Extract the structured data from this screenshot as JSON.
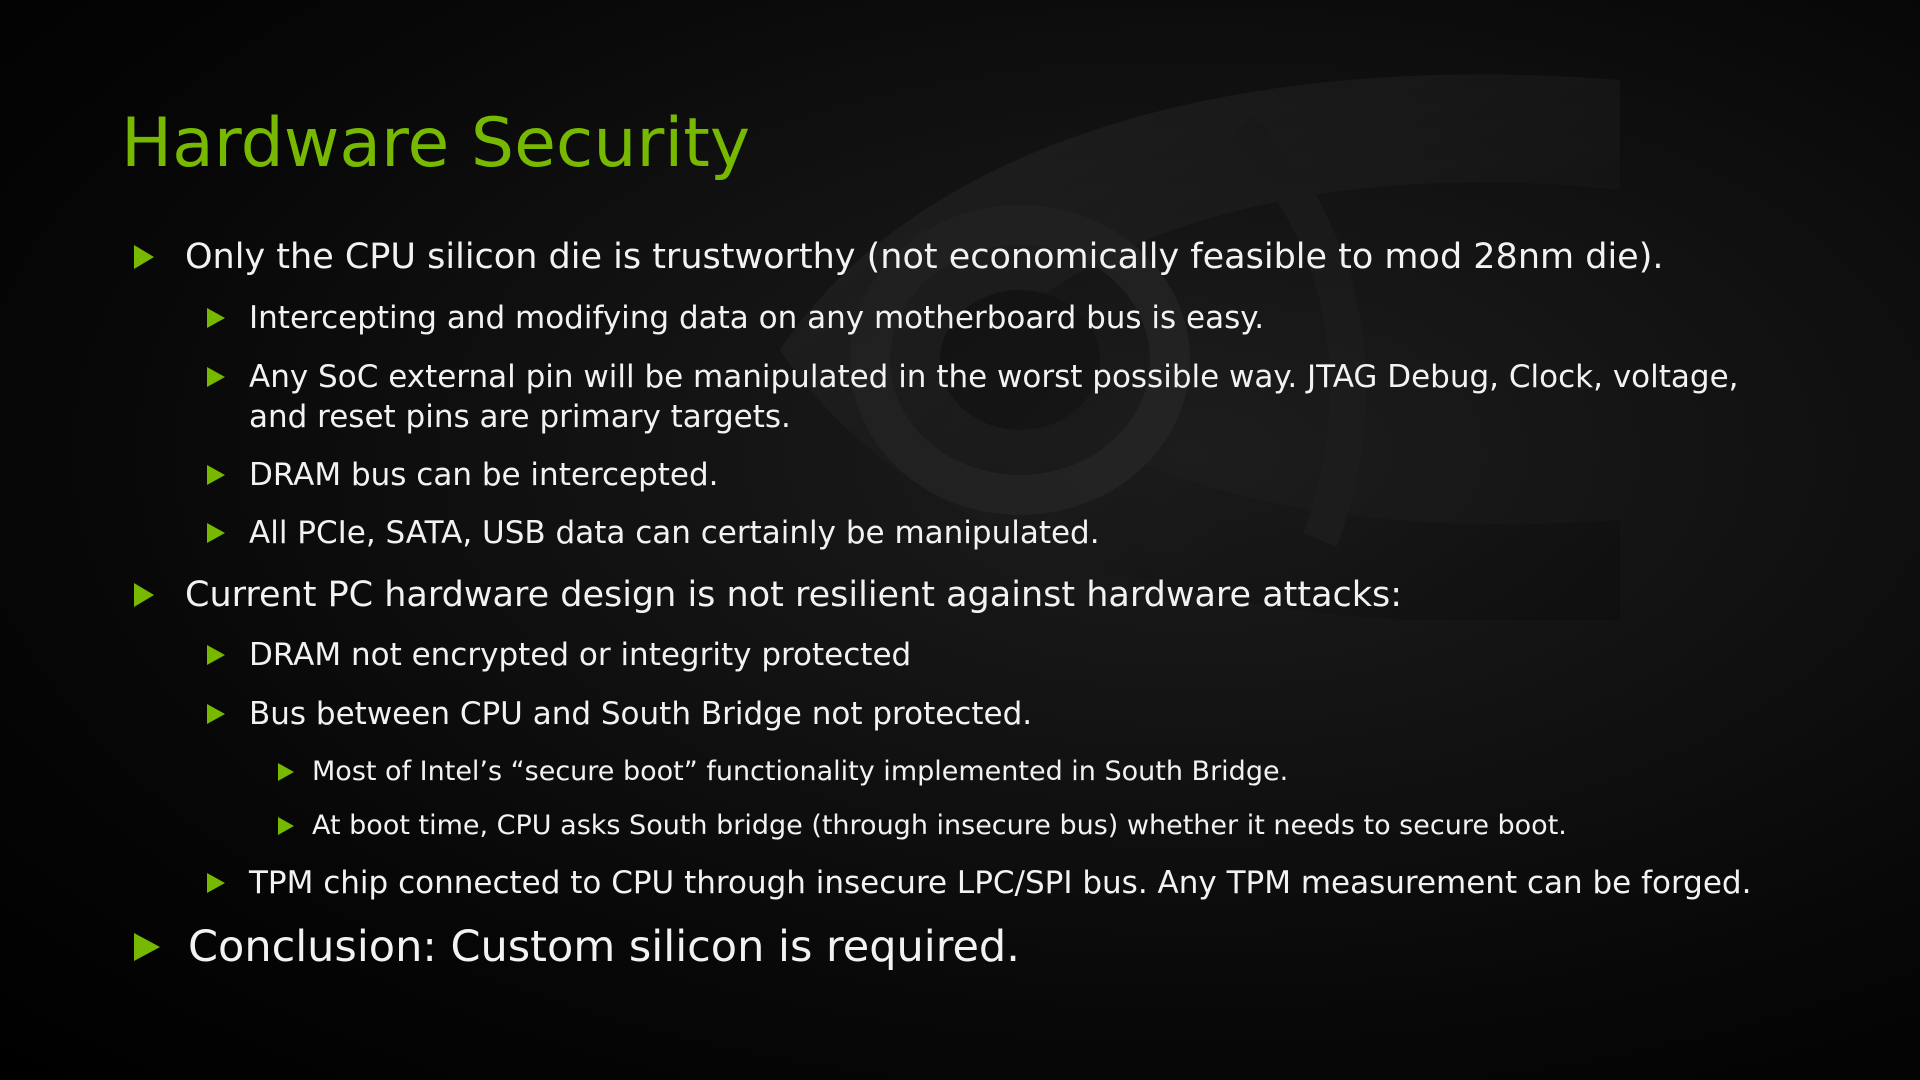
{
  "slide": {
    "title": "Hardware Security",
    "bullets": [
      "Only the CPU silicon die is trustworthy (not economically feasible to mod 28nm die).",
      "Intercepting and modifying data on any motherboard bus is easy.",
      "Any SoC external pin will be manipulated in the worst possible way. JTAG Debug, Clock, voltage,",
      "and reset pins are primary targets.",
      "DRAM bus can be intercepted.",
      "All PCIe, SATA, USB data can certainly be manipulated.",
      "Current PC hardware design is not resilient against hardware attacks:",
      "DRAM not encrypted or integrity protected",
      "Bus between CPU and South Bridge not protected.",
      "Most of Intel’s “secure boot” functionality implemented in South Bridge.",
      "At boot time, CPU asks South bridge (through insecure bus) whether it needs to secure boot.",
      "TPM chip connected to CPU through insecure LPC/SPI bus. Any TPM measurement can be forged.",
      "Conclusion: Custom silicon is required."
    ]
  },
  "colors": {
    "accent": "#76b900",
    "text": "#f2f2f2",
    "background": "#000000"
  },
  "icons": {
    "bullet": "triangle-right-icon",
    "background": "brand-eye-logo-icon"
  }
}
